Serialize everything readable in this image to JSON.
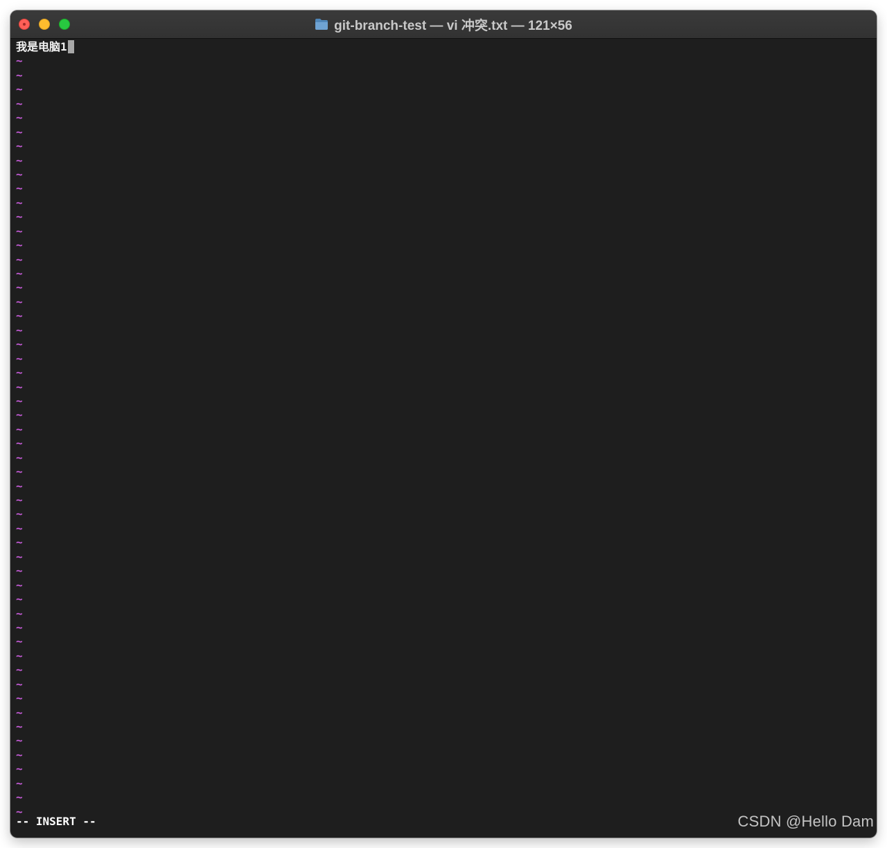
{
  "window": {
    "title": "git-branch-test — vi 冲突.txt — 121×56",
    "folder_icon": "folder-icon"
  },
  "editor": {
    "content_line": "我是电脑1",
    "empty_line_marker": "~",
    "empty_line_count": 54,
    "tilde_color": "#c45bd6",
    "background_color": "#1e1e1e"
  },
  "status": {
    "mode": "-- INSERT --"
  },
  "watermark": "CSDN @Hello Dam"
}
